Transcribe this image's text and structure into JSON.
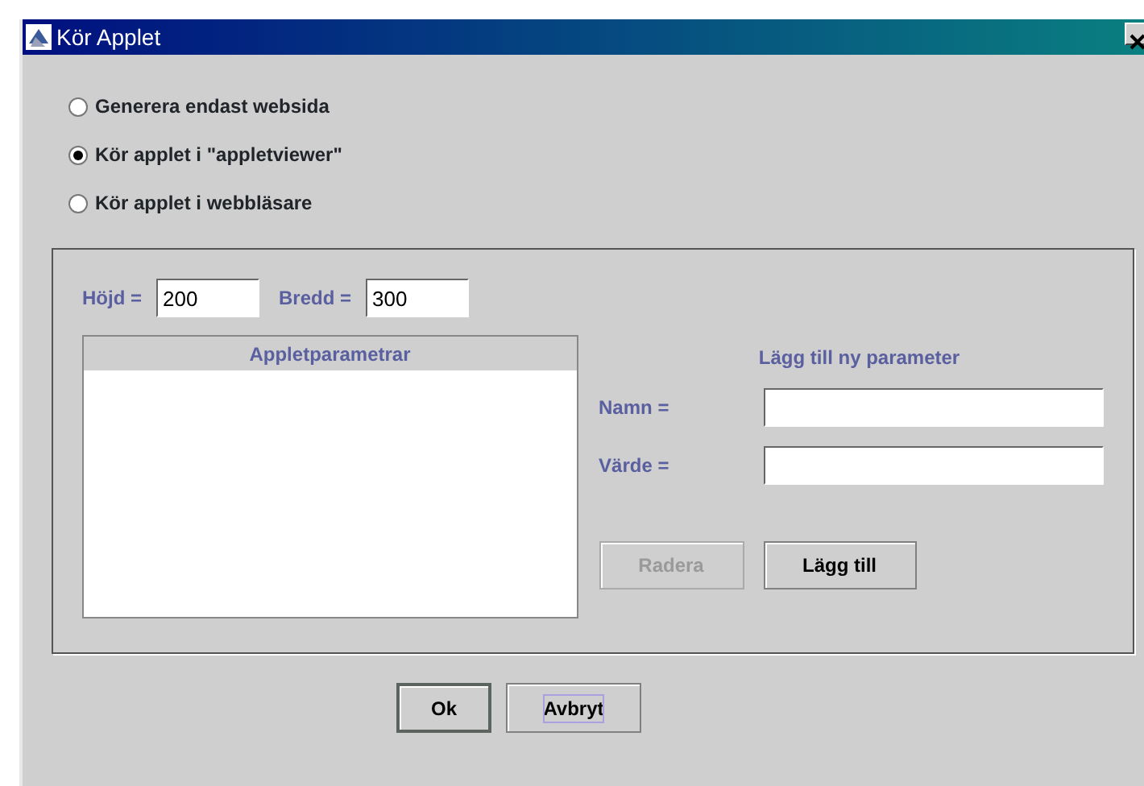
{
  "window": {
    "title": "Kör Applet"
  },
  "modes": [
    {
      "label": "Generera endast websida",
      "selected": false
    },
    {
      "label": "Kör applet i \"appletviewer\"",
      "selected": true
    },
    {
      "label": "Kör applet i webbläsare",
      "selected": false
    }
  ],
  "size": {
    "height_label": "Höjd =",
    "height_value": "200",
    "width_label": "Bredd =",
    "width_value": "300"
  },
  "parameters_table": {
    "heading": "Appletparametrar"
  },
  "new_parameter": {
    "heading": "Lägg till ny parameter",
    "name_label": "Namn =",
    "value_label": "Värde =",
    "buttons": [
      {
        "label": "Radera",
        "disabled": true,
        "focused": false
      },
      {
        "label": "Lägg till",
        "disabled": false,
        "focused": false
      }
    ]
  },
  "buttons": [
    {
      "label": "Ok",
      "default": true,
      "focused": false
    },
    {
      "label": "Avbryt",
      "default": false,
      "focused": true
    }
  ]
}
